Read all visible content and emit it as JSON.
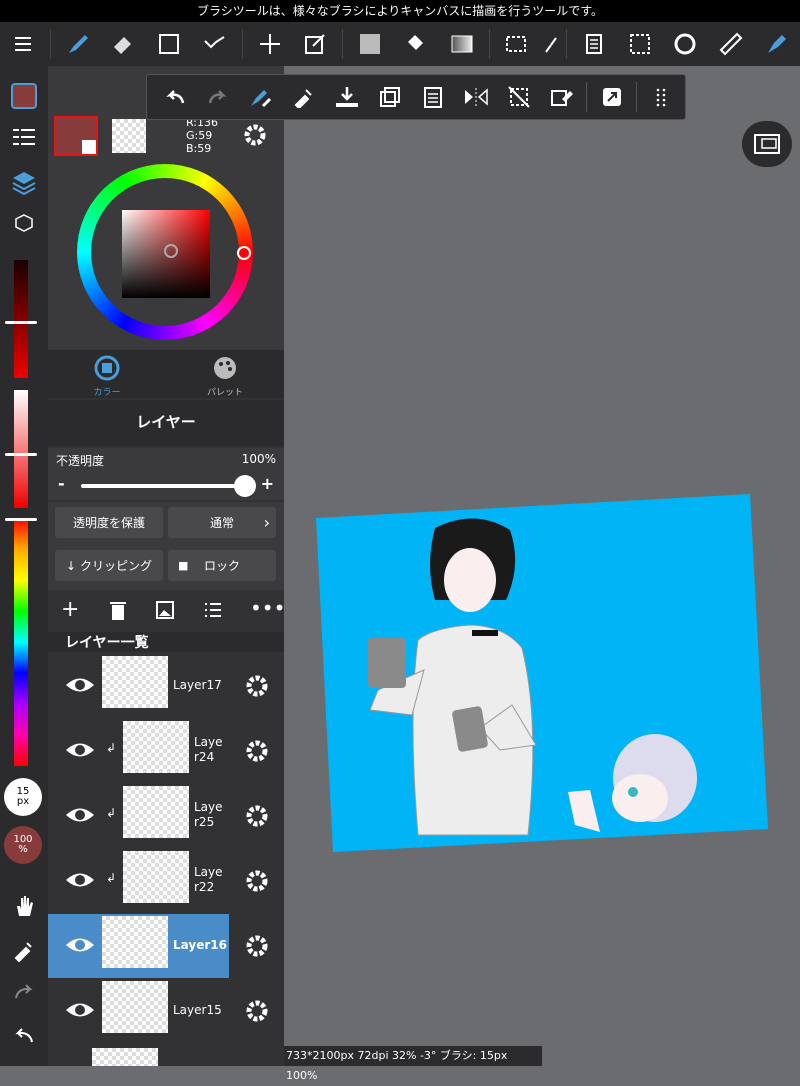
{
  "status_bar": {
    "text": "ブラシツールは、様々なブラシによりキャンバスに描画を行うツールです。"
  },
  "toolbar": {
    "icons": [
      "menu-icon",
      "brush-icon",
      "eraser-icon",
      "rectangle-icon",
      "vector-icon",
      "move-icon",
      "transform-icon",
      "fill-color-icon",
      "bucket-icon",
      "gradient-icon",
      "select-rect-icon",
      "select-pen-icon",
      "paste-icon",
      "select-dotted-icon",
      "rotate-canvas-icon",
      "ruler-icon",
      "pen-tool-icon"
    ]
  },
  "color_panel": {
    "current_color": "#883b3b",
    "rgb": {
      "r": "R:136",
      "g": "G:59",
      "b": "B:59"
    }
  },
  "panel_tabs": [
    {
      "label": "カラー",
      "active": true
    },
    {
      "label": "パレット",
      "active": false
    }
  ],
  "layer_panel": {
    "title": "レイヤー",
    "opacity_label": "不透明度",
    "opacity_value": "100%",
    "opacity_minus": "-",
    "opacity_plus": "+",
    "opacity_level": 1.0,
    "protect_alpha": "透明度を保護",
    "blend_mode": "通常",
    "clipping": "クリッピング",
    "lock": "ロック",
    "list_title": "レイヤー一覧",
    "layers": [
      {
        "name": "Layer17",
        "clipped": false,
        "selected": false
      },
      {
        "name": "Layer24",
        "clipped": true,
        "selected": false
      },
      {
        "name": "Layer25",
        "clipped": true,
        "selected": false
      },
      {
        "name": "Layer22",
        "clipped": true,
        "selected": false
      },
      {
        "name": "Layer16",
        "clipped": false,
        "selected": true
      },
      {
        "name": "Layer15",
        "clipped": false,
        "selected": false
      }
    ]
  },
  "left_strip": {
    "brush_size": "15",
    "brush_size_unit": "px",
    "brush_opacity": "100",
    "brush_opacity_unit": "%"
  },
  "info_bar": {
    "text": "733*2100px 72dpi 32% -3° ブラシ: 15px 100%"
  },
  "colors": {
    "accent": "#4a9eda",
    "canvas_bg": "#00b4f5",
    "selected_layer": "#4a8cc8"
  }
}
